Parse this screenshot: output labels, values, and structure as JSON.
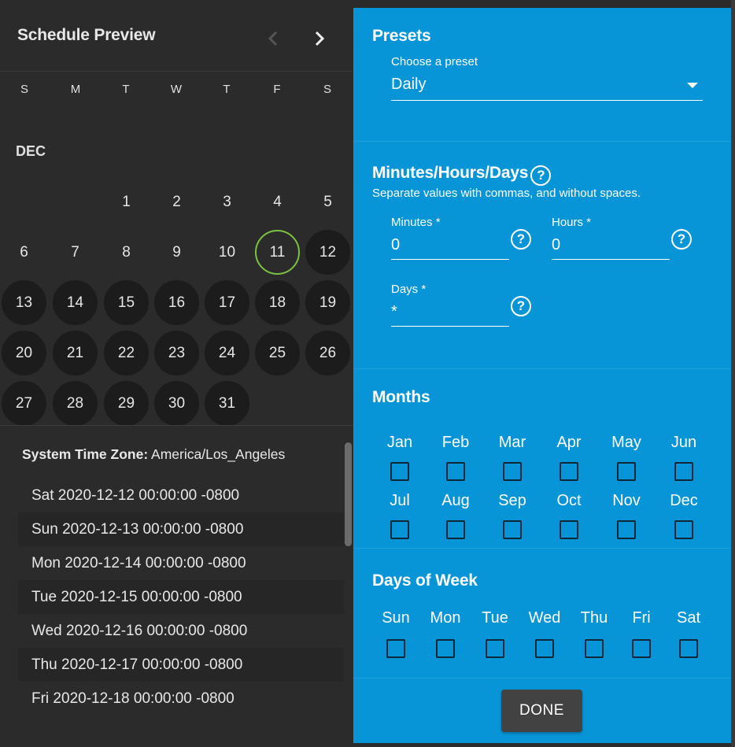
{
  "preview": {
    "title": "Schedule Preview",
    "weekdays": [
      "S",
      "M",
      "T",
      "W",
      "T",
      "F",
      "S"
    ],
    "month": "DEC",
    "days": [
      "1",
      "2",
      "3",
      "4",
      "5",
      "6",
      "7",
      "8",
      "9",
      "10",
      "11",
      "12",
      "13",
      "14",
      "15",
      "16",
      "17",
      "18",
      "19",
      "20",
      "21",
      "22",
      "23",
      "24",
      "25",
      "26",
      "27",
      "28",
      "29",
      "30",
      "31"
    ],
    "today": "11",
    "timezone_label": "System Time Zone:",
    "timezone_value": "America/Los_Angeles",
    "scheduled": [
      "Sat 2020-12-12 00:00:00 -0800",
      "Sun 2020-12-13 00:00:00 -0800",
      "Mon 2020-12-14 00:00:00 -0800",
      "Tue 2020-12-15 00:00:00 -0800",
      "Wed 2020-12-16 00:00:00 -0800",
      "Thu 2020-12-17 00:00:00 -0800",
      "Fri 2020-12-18 00:00:00 -0800"
    ]
  },
  "presets": {
    "title": "Presets",
    "select_label": "Choose a preset",
    "selected": "Daily"
  },
  "cron": {
    "title": "Minutes/Hours/Days",
    "help_glyph": "?",
    "hint": "Separate values with commas, and without spaces.",
    "minutes_label": "Minutes *",
    "minutes_value": "0",
    "hours_label": "Hours *",
    "hours_value": "0",
    "days_label": "Days *",
    "days_value": "*"
  },
  "months": {
    "title": "Months",
    "names": [
      "Jan",
      "Feb",
      "Mar",
      "Apr",
      "May",
      "Jun",
      "Jul",
      "Aug",
      "Sep",
      "Oct",
      "Nov",
      "Dec"
    ]
  },
  "dow": {
    "title": "Days of Week",
    "names": [
      "Sun",
      "Mon",
      "Tue",
      "Wed",
      "Thu",
      "Fri",
      "Sat"
    ]
  },
  "done_label": "DONE",
  "colors": {
    "panel_blue": "#0795d7",
    "dark_bg": "#2b2b2b",
    "today_ring": "#7bc142",
    "scheduled_day": "#1c1c1c"
  }
}
